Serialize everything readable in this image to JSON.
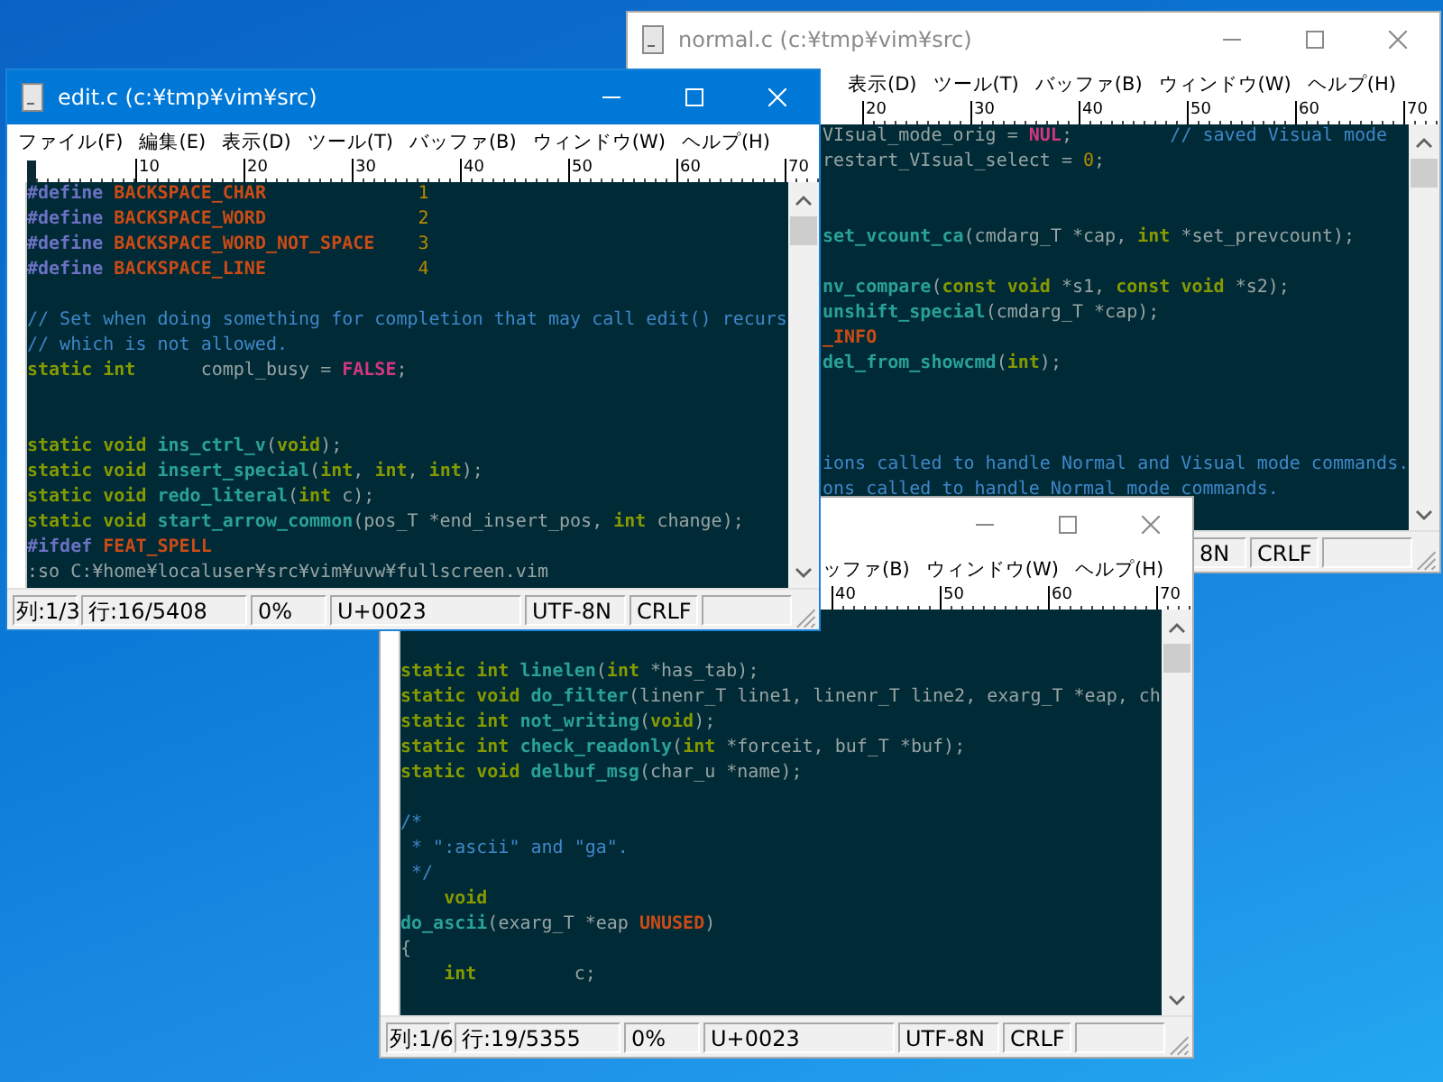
{
  "windows": [
    {
      "title": "normal.c (c:¥tmp¥vim¥src)",
      "active": false,
      "menu": [
        "表示(D)",
        "ツール(T)",
        "バッファ(B)",
        "ウィンドウ(W)",
        "ヘルプ(H)"
      ],
      "ruler": [
        "20",
        "30",
        "40",
        "50",
        "60",
        "70"
      ],
      "lines": [
        {
          "tokens": [
            {
              "kind": "plain",
              "text": "VIsual_mode_orig = "
            },
            {
              "kind": "special",
              "text": "NUL"
            },
            {
              "kind": "plain",
              "text": ";         "
            },
            {
              "kind": "comment",
              "text": "// saved Visual mode"
            }
          ]
        },
        {
          "tokens": [
            {
              "kind": "plain",
              "text": "restart_VIsual_select = "
            },
            {
              "kind": "number",
              "text": "0"
            },
            {
              "kind": "plain",
              "text": ";"
            }
          ]
        },
        {
          "blank": true
        },
        {
          "blank": true
        },
        {
          "tokens": [
            {
              "kind": "func",
              "text": "set_vcount_ca"
            },
            {
              "kind": "plain",
              "text": "(cmdarg_T *cap, "
            },
            {
              "kind": "type",
              "text": "int"
            },
            {
              "kind": "plain",
              "text": " *set_prevcount);"
            }
          ]
        },
        {
          "blank": true
        },
        {
          "tokens": [
            {
              "kind": "func",
              "text": "nv_compare"
            },
            {
              "kind": "plain",
              "text": "("
            },
            {
              "kind": "type",
              "text": "const void"
            },
            {
              "kind": "plain",
              "text": " *s1, "
            },
            {
              "kind": "type",
              "text": "const void"
            },
            {
              "kind": "plain",
              "text": " *s2);"
            }
          ]
        },
        {
          "tokens": [
            {
              "kind": "func",
              "text": "unshift_special"
            },
            {
              "kind": "plain",
              "text": "(cmdarg_T *cap);"
            }
          ]
        },
        {
          "tokens": [
            {
              "kind": "const",
              "text": "_INFO"
            }
          ]
        },
        {
          "tokens": [
            {
              "kind": "func",
              "text": "del_from_showcmd"
            },
            {
              "kind": "plain",
              "text": "("
            },
            {
              "kind": "type",
              "text": "int"
            },
            {
              "kind": "plain",
              "text": ");"
            }
          ]
        },
        {
          "blank": true
        },
        {
          "blank": true
        },
        {
          "blank": true
        },
        {
          "tokens": [
            {
              "kind": "comment",
              "text": "ions called to handle Normal and Visual mode commands."
            }
          ]
        },
        {
          "tokens": [
            {
              "kind": "comment",
              "text": "ons called to handle Normal mode commands."
            }
          ]
        }
      ],
      "status": [
        "8N",
        "CRLF"
      ]
    },
    {
      "active": false,
      "menu": [
        "ッファ(B)",
        "ウィンドウ(W)",
        "ヘルプ(H)"
      ],
      "ruler": [
        "40",
        "50",
        "60",
        "70"
      ],
      "lines": [
        {
          "blank": true
        },
        {
          "blank": true
        },
        {
          "tokens": [
            {
              "kind": "type",
              "text": "static int "
            },
            {
              "kind": "func",
              "text": "linelen"
            },
            {
              "kind": "plain",
              "text": "("
            },
            {
              "kind": "type",
              "text": "int"
            },
            {
              "kind": "plain",
              "text": " *has_tab);"
            }
          ]
        },
        {
          "tokens": [
            {
              "kind": "type",
              "text": "static void "
            },
            {
              "kind": "func",
              "text": "do_filter"
            },
            {
              "kind": "plain",
              "text": "(linenr_T line1, linenr_T line2, exarg_T *eap, ch"
            }
          ]
        },
        {
          "tokens": [
            {
              "kind": "type",
              "text": "static int "
            },
            {
              "kind": "func",
              "text": "not_writing"
            },
            {
              "kind": "plain",
              "text": "("
            },
            {
              "kind": "type",
              "text": "void"
            },
            {
              "kind": "plain",
              "text": ");"
            }
          ]
        },
        {
          "tokens": [
            {
              "kind": "type",
              "text": "static int "
            },
            {
              "kind": "func",
              "text": "check_readonly"
            },
            {
              "kind": "plain",
              "text": "("
            },
            {
              "kind": "type",
              "text": "int"
            },
            {
              "kind": "plain",
              "text": " *forceit, buf_T *buf);"
            }
          ]
        },
        {
          "tokens": [
            {
              "kind": "type",
              "text": "static void "
            },
            {
              "kind": "func",
              "text": "delbuf_msg"
            },
            {
              "kind": "plain",
              "text": "(char_u *name);"
            }
          ]
        },
        {
          "blank": true
        },
        {
          "tokens": [
            {
              "kind": "comment",
              "text": "/*"
            }
          ]
        },
        {
          "tokens": [
            {
              "kind": "comment",
              "text": " * \":ascii\" and \"ga\"."
            }
          ]
        },
        {
          "tokens": [
            {
              "kind": "comment",
              "text": " */"
            }
          ]
        },
        {
          "tokens": [
            {
              "kind": "type",
              "text": "    void"
            }
          ]
        },
        {
          "tokens": [
            {
              "kind": "func",
              "text": "do_ascii"
            },
            {
              "kind": "plain",
              "text": "(exarg_T *eap "
            },
            {
              "kind": "const",
              "text": "UNUSED"
            },
            {
              "kind": "plain",
              "text": ")"
            }
          ]
        },
        {
          "tokens": [
            {
              "kind": "plain",
              "text": "{"
            }
          ]
        },
        {
          "tokens": [
            {
              "kind": "type",
              "text": "    int"
            },
            {
              "kind": "plain",
              "text": "         c;"
            }
          ]
        }
      ],
      "status": [
        "列:1/6",
        "行:19/5355",
        "0%",
        "U+0023",
        "UTF-8N",
        "CRLF"
      ]
    },
    {
      "title": "edit.c (c:¥tmp¥vim¥src)",
      "active": true,
      "menu": [
        "ファイル(F)",
        "編集(E)",
        "表示(D)",
        "ツール(T)",
        "バッファ(B)",
        "ウィンドウ(W)",
        "ヘルプ(H)"
      ],
      "ruler": [
        "10",
        "20",
        "30",
        "40",
        "50",
        "60",
        "70"
      ],
      "lines": [
        {
          "tokens": [
            {
              "kind": "preproc",
              "text": "#define "
            },
            {
              "kind": "const",
              "text": "BACKSPACE_CHAR"
            },
            {
              "kind": "number",
              "text": "              1"
            }
          ]
        },
        {
          "tokens": [
            {
              "kind": "preproc",
              "text": "#define "
            },
            {
              "kind": "const",
              "text": "BACKSPACE_WORD"
            },
            {
              "kind": "number",
              "text": "              2"
            }
          ]
        },
        {
          "tokens": [
            {
              "kind": "preproc",
              "text": "#define "
            },
            {
              "kind": "const",
              "text": "BACKSPACE_WORD_NOT_SPACE"
            },
            {
              "kind": "number",
              "text": "    3"
            }
          ]
        },
        {
          "tokens": [
            {
              "kind": "preproc",
              "text": "#define "
            },
            {
              "kind": "const",
              "text": "BACKSPACE_LINE"
            },
            {
              "kind": "number",
              "text": "              4"
            }
          ]
        },
        {
          "blank": true
        },
        {
          "tokens": [
            {
              "kind": "comment",
              "text": "// Set when doing something for completion that may call edit() recurs"
            }
          ]
        },
        {
          "tokens": [
            {
              "kind": "comment",
              "text": "// which is not allowed."
            }
          ]
        },
        {
          "tokens": [
            {
              "kind": "type",
              "text": "static int"
            },
            {
              "kind": "plain",
              "text": "      compl_busy = "
            },
            {
              "kind": "special",
              "text": "FALSE"
            },
            {
              "kind": "plain",
              "text": ";"
            }
          ]
        },
        {
          "blank": true
        },
        {
          "blank": true
        },
        {
          "tokens": [
            {
              "kind": "type",
              "text": "static void "
            },
            {
              "kind": "func",
              "text": "ins_ctrl_v"
            },
            {
              "kind": "plain",
              "text": "("
            },
            {
              "kind": "type",
              "text": "void"
            },
            {
              "kind": "plain",
              "text": ");"
            }
          ]
        },
        {
          "tokens": [
            {
              "kind": "type",
              "text": "static void "
            },
            {
              "kind": "func",
              "text": "insert_special"
            },
            {
              "kind": "plain",
              "text": "("
            },
            {
              "kind": "type",
              "text": "int"
            },
            {
              "kind": "plain",
              "text": ", "
            },
            {
              "kind": "type",
              "text": "int"
            },
            {
              "kind": "plain",
              "text": ", "
            },
            {
              "kind": "type",
              "text": "int"
            },
            {
              "kind": "plain",
              "text": ");"
            }
          ]
        },
        {
          "tokens": [
            {
              "kind": "type",
              "text": "static void "
            },
            {
              "kind": "func",
              "text": "redo_literal"
            },
            {
              "kind": "plain",
              "text": "("
            },
            {
              "kind": "type",
              "text": "int"
            },
            {
              "kind": "plain",
              "text": " c);"
            }
          ]
        },
        {
          "tokens": [
            {
              "kind": "type",
              "text": "static void "
            },
            {
              "kind": "func",
              "text": "start_arrow_common"
            },
            {
              "kind": "plain",
              "text": "(pos_T *end_insert_pos, "
            },
            {
              "kind": "type",
              "text": "int"
            },
            {
              "kind": "plain",
              "text": " change);"
            }
          ]
        },
        {
          "tokens": [
            {
              "kind": "preproc",
              "text": "#ifdef "
            },
            {
              "kind": "const",
              "text": "FEAT_SPELL"
            }
          ]
        },
        {
          "tokens": [
            {
              "kind": "plain",
              "text": ":so C:¥home¥localuser¥src¥vim¥uvw¥fullscreen.vim"
            }
          ]
        }
      ],
      "status": [
        "列:1/3",
        "行:16/5408",
        "0%",
        "U+0023",
        "UTF-8N",
        "CRLF"
      ]
    }
  ]
}
